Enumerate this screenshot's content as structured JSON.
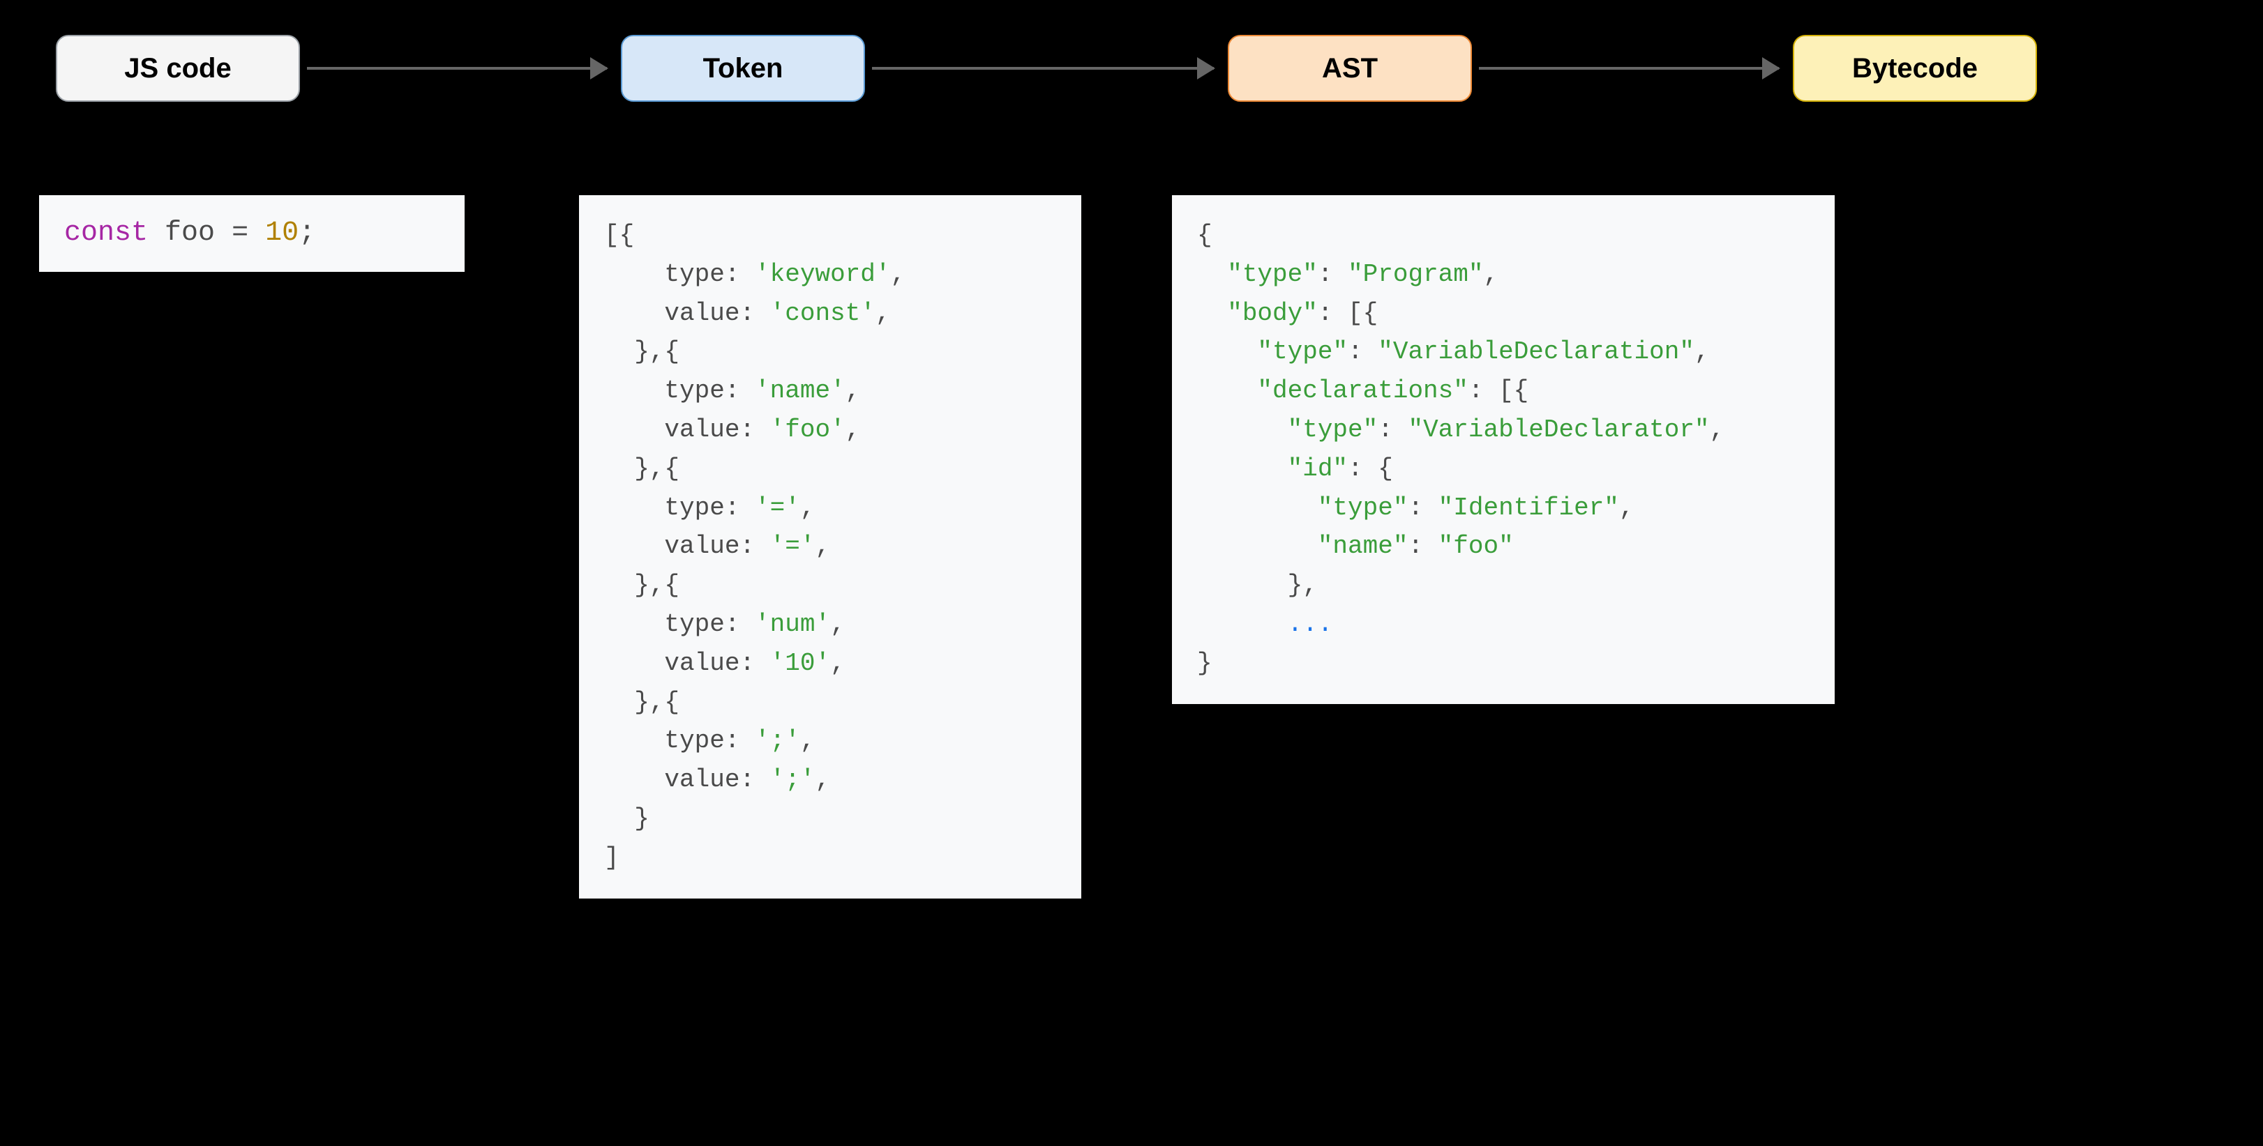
{
  "stages": {
    "js": "JS code",
    "token": "Token",
    "ast": "AST",
    "byte": "Bytecode"
  },
  "js_source": {
    "keyword": "const",
    "space1": " ",
    "name": "foo",
    "space2": " ",
    "op": "=",
    "space3": " ",
    "num": "10",
    "semi": ";"
  },
  "token_panel": {
    "l0": "[{",
    "l1a": "    type: ",
    "l1b": "'keyword'",
    "l1c": ",",
    "l2a": "    value: ",
    "l2b": "'const'",
    "l2c": ",",
    "l3": "  },{",
    "l4a": "    type: ",
    "l4b": "'name'",
    "l4c": ",",
    "l5a": "    value: ",
    "l5b": "'foo'",
    "l5c": ",",
    "l6": "  },{",
    "l7a": "    type: ",
    "l7b": "'='",
    "l7c": ",",
    "l8a": "    value: ",
    "l8b": "'='",
    "l8c": ",",
    "l9": "  },{",
    "l10a": "    type: ",
    "l10b": "'num'",
    "l10c": ",",
    "l11a": "    value: ",
    "l11b": "'10'",
    "l11c": ",",
    "l12": "  },{",
    "l13a": "    type: ",
    "l13b": "';'",
    "l13c": ",",
    "l14a": "    value: ",
    "l14b": "';'",
    "l14c": ",",
    "l15": "  }",
    "l16": "]"
  },
  "ast_panel": {
    "l0": "{",
    "l1a": "  ",
    "l1b": "\"type\"",
    "l1c": ": ",
    "l1d": "\"Program\"",
    "l1e": ",",
    "l2a": "  ",
    "l2b": "\"body\"",
    "l2c": ": [{",
    "l3a": "    ",
    "l3b": "\"type\"",
    "l3c": ": ",
    "l3d": "\"VariableDeclaration\"",
    "l3e": ",",
    "l4a": "    ",
    "l4b": "\"declarations\"",
    "l4c": ": [{",
    "l5a": "      ",
    "l5b": "\"type\"",
    "l5c": ": ",
    "l5d": "\"VariableDeclarator\"",
    "l5e": ",",
    "l6a": "      ",
    "l6b": "\"id\"",
    "l6c": ": {",
    "l7a": "        ",
    "l7b": "\"type\"",
    "l7c": ": ",
    "l7d": "\"Identifier\"",
    "l7e": ",",
    "l8a": "        ",
    "l8b": "\"name\"",
    "l8c": ": ",
    "l8d": "\"foo\"",
    "l9": "      },",
    "l10a": "      ",
    "l10b": "...",
    "l11": "}"
  }
}
